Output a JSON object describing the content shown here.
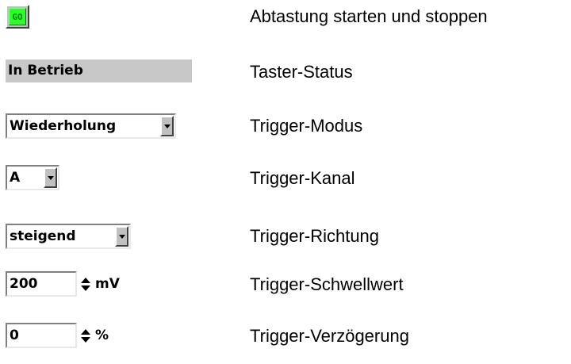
{
  "controls": {
    "go_label": "GO",
    "status_text": "In Betrieb",
    "trigger_mode": "Wiederholung",
    "trigger_channel": "A",
    "trigger_direction": "steigend",
    "threshold_value": "200",
    "threshold_unit": "mV",
    "delay_value": "0",
    "delay_unit": "%"
  },
  "descriptions": [
    "Abtastung starten und stoppen",
    "Taster-Status",
    "Trigger-Modus",
    "Trigger-Kanal",
    "Trigger-Richtung",
    "Trigger-Schwellwert",
    "Trigger-Verzögerung"
  ],
  "icons": {
    "dropdown": "triangle-down",
    "spinner": "up-down-arrows"
  },
  "colors": {
    "go_button": "#2aff2a",
    "status_panel": "#c8c8c8"
  }
}
